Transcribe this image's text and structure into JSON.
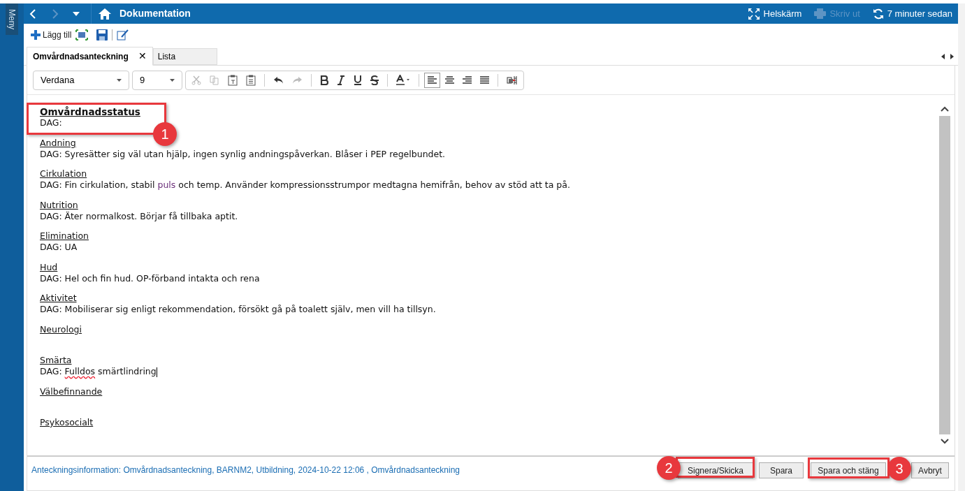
{
  "sidebar": {
    "label": "Meny"
  },
  "header": {
    "title": "Dokumentation",
    "actions": [
      {
        "label": "Helskärm",
        "disabled": false,
        "kind": "fullscreen"
      },
      {
        "label": "Skriv ut",
        "disabled": true,
        "kind": "print"
      },
      {
        "label": "7 minuter sedan",
        "disabled": false,
        "kind": "refresh"
      }
    ]
  },
  "toolbar": {
    "add_label": "Lägg till"
  },
  "tabs": [
    {
      "label": "Omvårdnadsanteckning",
      "selected": true,
      "close": "✕"
    },
    {
      "label": "Lista",
      "selected": false
    }
  ],
  "editor_toolbar": {
    "font": "Verdana",
    "size": "9"
  },
  "sections": [
    {
      "heading": "Omvårdnadsstatus",
      "bold": true,
      "lines": [
        [
          {
            "text": "DAG:",
            "kind": "plain"
          }
        ]
      ]
    },
    {
      "heading": "Andning",
      "bold": false,
      "lines": [
        [
          {
            "text": "DAG: Syresätter sig väl utan hjälp, ingen synlig andningspåverkan. Blåser i PEP regelbundet.",
            "kind": "plain"
          }
        ]
      ]
    },
    {
      "heading": "Cirkulation",
      "bold": false,
      "lines": [
        [
          {
            "text": "DAG: Fin cirkulation, stabil ",
            "kind": "plain"
          },
          {
            "text": "puls",
            "kind": "term"
          },
          {
            "text": " och temp. Använder kompressionsstrumpor medtagna hemifrån, behov av stöd att ta på.",
            "kind": "plain"
          }
        ]
      ]
    },
    {
      "heading": "Nutrition",
      "bold": false,
      "lines": [
        [
          {
            "text": "DAG: Äter normalkost. Börjar få tillbaka aptit.",
            "kind": "plain"
          }
        ]
      ]
    },
    {
      "heading": "Elimination",
      "bold": false,
      "lines": [
        [
          {
            "text": "DAG: UA",
            "kind": "plain"
          }
        ]
      ]
    },
    {
      "heading": "Hud",
      "bold": false,
      "lines": [
        [
          {
            "text": "DAG: Hel och fin hud. OP-förband intakta och rena",
            "kind": "plain"
          }
        ]
      ]
    },
    {
      "heading": "Aktivitet",
      "bold": false,
      "lines": [
        [
          {
            "text": "DAG: Mobiliserar sig enligt rekommendation, försökt gå på toalett själv, men vill ha tillsyn.",
            "kind": "plain"
          }
        ]
      ]
    },
    {
      "heading": "Neurologi",
      "bold": false
    },
    {
      "heading": "Smärta",
      "bold": false,
      "lines": [
        [
          {
            "text": "DAG: ",
            "kind": "plain"
          },
          {
            "text": "Fulldos",
            "kind": "misspelled"
          },
          {
            "text": " smärtlindring",
            "kind": "plain"
          }
        ]
      ]
    },
    {
      "heading": "Välbefinnande",
      "bold": false
    },
    {
      "heading": "Psykosocialt",
      "bold": false
    }
  ],
  "footer": {
    "info": "Anteckningsinformation: Omvårdnadsanteckning, BARNM2, Utbildning, 2024-10-22 12:06 , Omvårdnadsanteckning",
    "buttons": [
      "Signera/Skicka",
      "Spara",
      "Spara och stäng",
      "Avbryt"
    ]
  },
  "callouts": [
    {
      "number": "1"
    },
    {
      "number": "2"
    },
    {
      "number": "3"
    }
  ]
}
